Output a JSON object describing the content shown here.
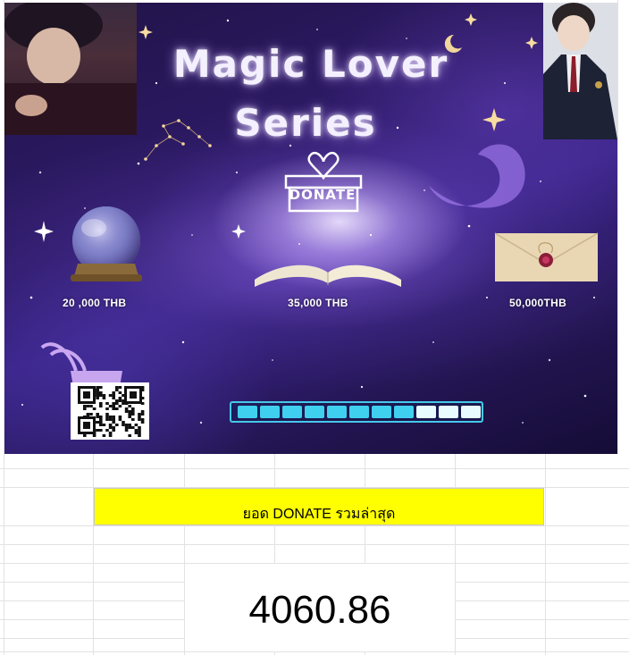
{
  "banner": {
    "title_line1": "Magic Lover",
    "title_line2": "Series",
    "donate_label": "DONATE",
    "tiers": [
      {
        "label": "20 ,000 THB",
        "icon": "crystal-ball-icon"
      },
      {
        "label": "35,000 THB",
        "icon": "open-book-icon"
      },
      {
        "label": "50,000THB",
        "icon": "envelope-icon"
      }
    ],
    "progress": {
      "filled_segments": 8,
      "total_segments": 11
    },
    "colors": {
      "progress_filled": "#3fd0f0",
      "progress_empty": "#e8fbff",
      "progress_border": "#46c8e8"
    }
  },
  "sheet": {
    "donate_header": "ยอด DONATE รวมล่าสุด",
    "donate_total": "4060.86",
    "colors": {
      "header_fill": "#ffff00",
      "gridline": "#e0e0e0"
    }
  }
}
